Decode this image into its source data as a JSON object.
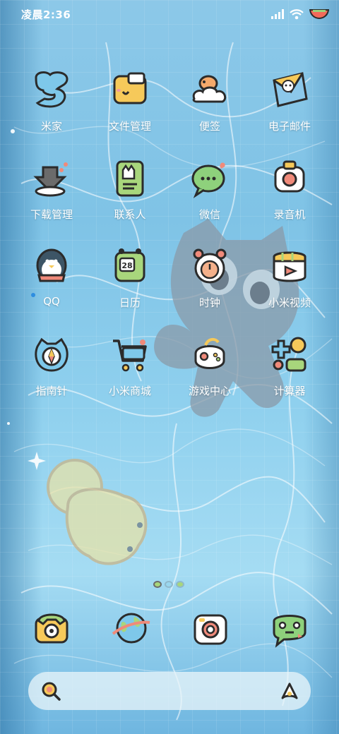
{
  "status_bar": {
    "time": "凌晨2:36",
    "icons": [
      "signal-icon",
      "wifi-icon",
      "battery-icon"
    ]
  },
  "apps": [
    {
      "label": "米家",
      "icon": "mijia-icon"
    },
    {
      "label": "文件管理",
      "icon": "file-manager-icon"
    },
    {
      "label": "便签",
      "icon": "notes-icon"
    },
    {
      "label": "电子邮件",
      "icon": "email-icon"
    },
    {
      "label": "下载管理",
      "icon": "download-icon"
    },
    {
      "label": "联系人",
      "icon": "contacts-icon"
    },
    {
      "label": "微信",
      "icon": "wechat-icon"
    },
    {
      "label": "录音机",
      "icon": "recorder-icon"
    },
    {
      "label": "QQ",
      "icon": "qq-icon"
    },
    {
      "label": "日历",
      "icon": "calendar-icon",
      "date": "28"
    },
    {
      "label": "时钟",
      "icon": "clock-icon"
    },
    {
      "label": "小米视频",
      "icon": "video-icon"
    },
    {
      "label": "指南针",
      "icon": "compass-icon"
    },
    {
      "label": "小米商城",
      "icon": "store-icon"
    },
    {
      "label": "游戏中心",
      "icon": "game-center-icon"
    },
    {
      "label": "计算器",
      "icon": "calculator-icon"
    }
  ],
  "dock": [
    {
      "icon": "phone-icon"
    },
    {
      "icon": "browser-icon"
    },
    {
      "icon": "camera-icon"
    },
    {
      "icon": "messages-icon"
    }
  ],
  "search_bar": {
    "left_icon": "search-icon",
    "right_icon": "assistant-icon"
  },
  "colors": {
    "label": "#ffffff",
    "water": "#8cc8e8",
    "outline": "#2b2b2b",
    "notification_dot": "#2d8de0"
  }
}
